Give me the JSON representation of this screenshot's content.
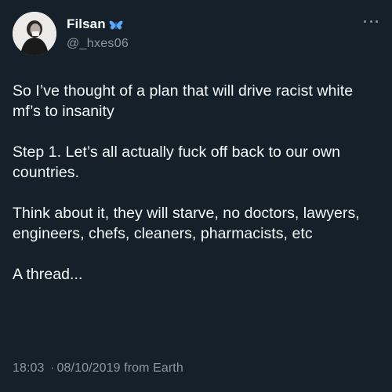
{
  "author": {
    "display_name": "Filsan",
    "badge_icon": "butterfly-icon",
    "badge_color": "#5aa9ff",
    "handle": "@_hxes06",
    "avatar": "avatar"
  },
  "menu": {
    "icon": "more-options-icon"
  },
  "tweet": {
    "paragraphs": [
      "So I’ve thought of a plan that will drive racist white mf’s to insanity",
      "Step 1. Let’s all actually fuck off back to our own countries.",
      "Think about it, they will starve, no doctors, lawyers, engineers, chefs, cleaners, pharmacists, etc",
      "A thread..."
    ]
  },
  "meta": {
    "time": "18:03",
    "separator": "·",
    "date": "08/10/2019",
    "source_prefix": "from",
    "source": "Earth"
  },
  "colors": {
    "background": "#15202b",
    "text": "#f7f9f9",
    "secondary_text": "#8b98a5"
  }
}
